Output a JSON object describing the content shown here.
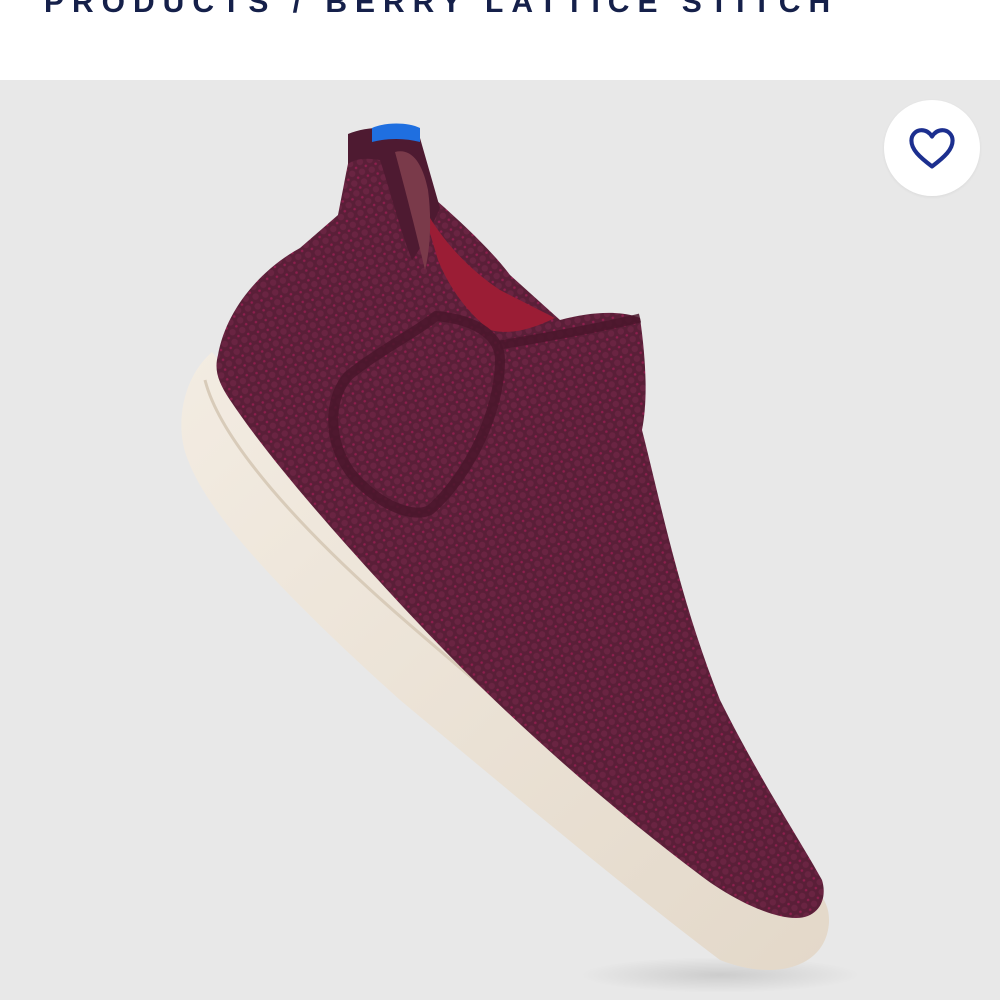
{
  "header": {
    "breadcrumb": "PRODUCTS / BERRY LATTICE STITCH"
  },
  "product": {
    "image_subject": "berry knit slip-on high-top sneaker",
    "colors": {
      "knit": "#5a1f38",
      "sole": "#ece3d6",
      "pull_tab": "#1f6fe0",
      "lining": "#9b1d35"
    }
  },
  "favorite": {
    "icon": "heart-outline-icon",
    "color": "#1c2f8f"
  },
  "theme": {
    "breadcrumb_color": "#15204a",
    "image_background": "#e8e8e8"
  }
}
